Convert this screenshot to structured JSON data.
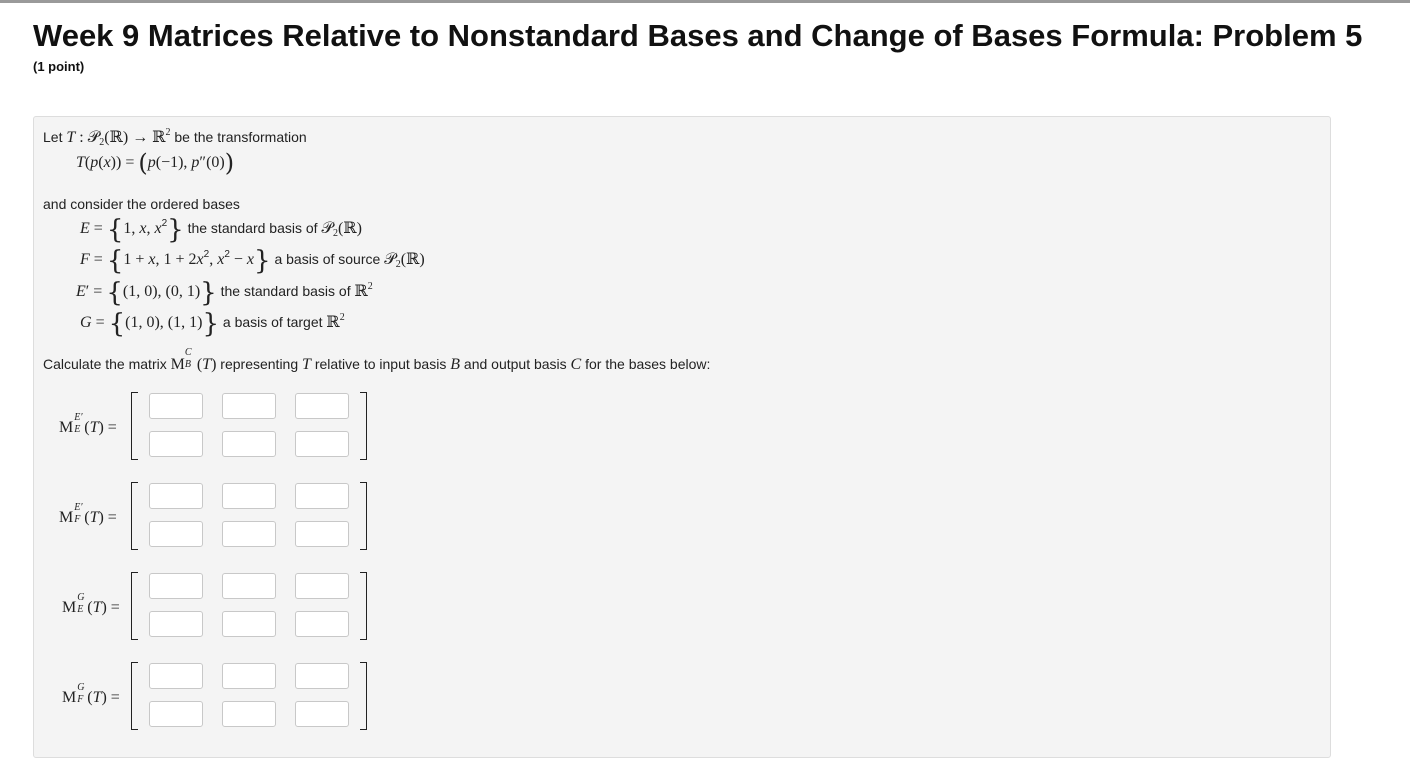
{
  "header": {
    "title": "Week 9 Matrices Relative to Nonstandard Bases and Change of Bases Formula: Problem 5",
    "points": "(1 point)"
  },
  "problem": {
    "intro_text": "be the transformation",
    "let": "Let",
    "consider_text": "and consider the ordered bases",
    "E_desc": "the standard basis of",
    "F_desc": "a basis of source",
    "Eprime_desc": "the standard basis of",
    "G_desc": "a basis of target",
    "calc_text_1": "Calculate the matrix",
    "calc_text_2": "representing",
    "calc_text_3": "relative to input basis",
    "calc_text_4": "and output basis",
    "calc_text_5": "for the bases below:"
  },
  "matrices": [
    {
      "sup": "E′",
      "sub": "E",
      "cells": [
        "",
        "",
        "",
        "",
        "",
        ""
      ]
    },
    {
      "sup": "E′",
      "sub": "F",
      "cells": [
        "",
        "",
        "",
        "",
        "",
        ""
      ]
    },
    {
      "sup": "G",
      "sub": "E",
      "cells": [
        "",
        "",
        "",
        "",
        "",
        ""
      ]
    },
    {
      "sup": "G",
      "sub": "F",
      "cells": [
        "",
        "",
        "",
        "",
        "",
        ""
      ]
    }
  ]
}
